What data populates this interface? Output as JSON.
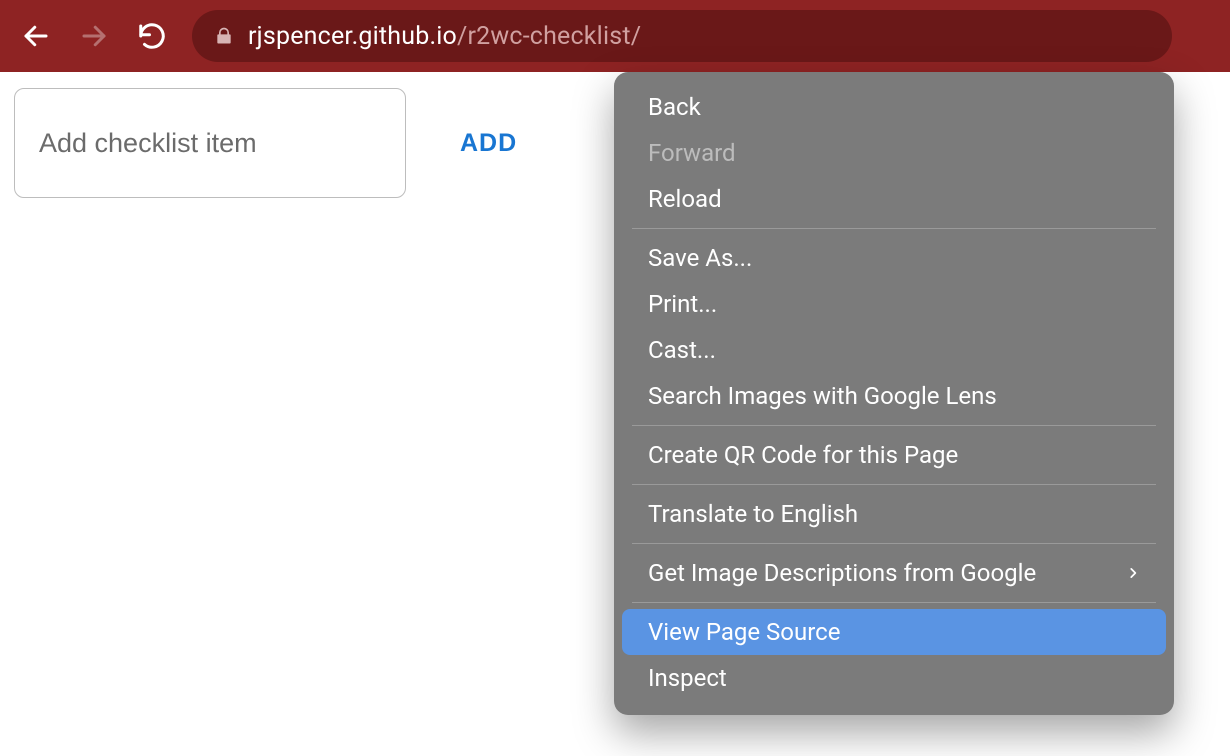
{
  "browser": {
    "url_host": "rjspencer.github.io",
    "url_path": "/r2wc-checklist/"
  },
  "form": {
    "input_placeholder": "Add checklist item",
    "input_value": "",
    "add_label": "ADD"
  },
  "context_menu": {
    "groups": [
      [
        {
          "label": "Back",
          "disabled": false,
          "submenu": false,
          "highlighted": false
        },
        {
          "label": "Forward",
          "disabled": true,
          "submenu": false,
          "highlighted": false
        },
        {
          "label": "Reload",
          "disabled": false,
          "submenu": false,
          "highlighted": false
        }
      ],
      [
        {
          "label": "Save As...",
          "disabled": false,
          "submenu": false,
          "highlighted": false
        },
        {
          "label": "Print...",
          "disabled": false,
          "submenu": false,
          "highlighted": false
        },
        {
          "label": "Cast...",
          "disabled": false,
          "submenu": false,
          "highlighted": false
        },
        {
          "label": "Search Images with Google Lens",
          "disabled": false,
          "submenu": false,
          "highlighted": false
        }
      ],
      [
        {
          "label": "Create QR Code for this Page",
          "disabled": false,
          "submenu": false,
          "highlighted": false
        }
      ],
      [
        {
          "label": "Translate to English",
          "disabled": false,
          "submenu": false,
          "highlighted": false
        }
      ],
      [
        {
          "label": "Get Image Descriptions from Google",
          "disabled": false,
          "submenu": true,
          "highlighted": false
        }
      ],
      [
        {
          "label": "View Page Source",
          "disabled": false,
          "submenu": false,
          "highlighted": true
        },
        {
          "label": "Inspect",
          "disabled": false,
          "submenu": false,
          "highlighted": false
        }
      ]
    ]
  }
}
